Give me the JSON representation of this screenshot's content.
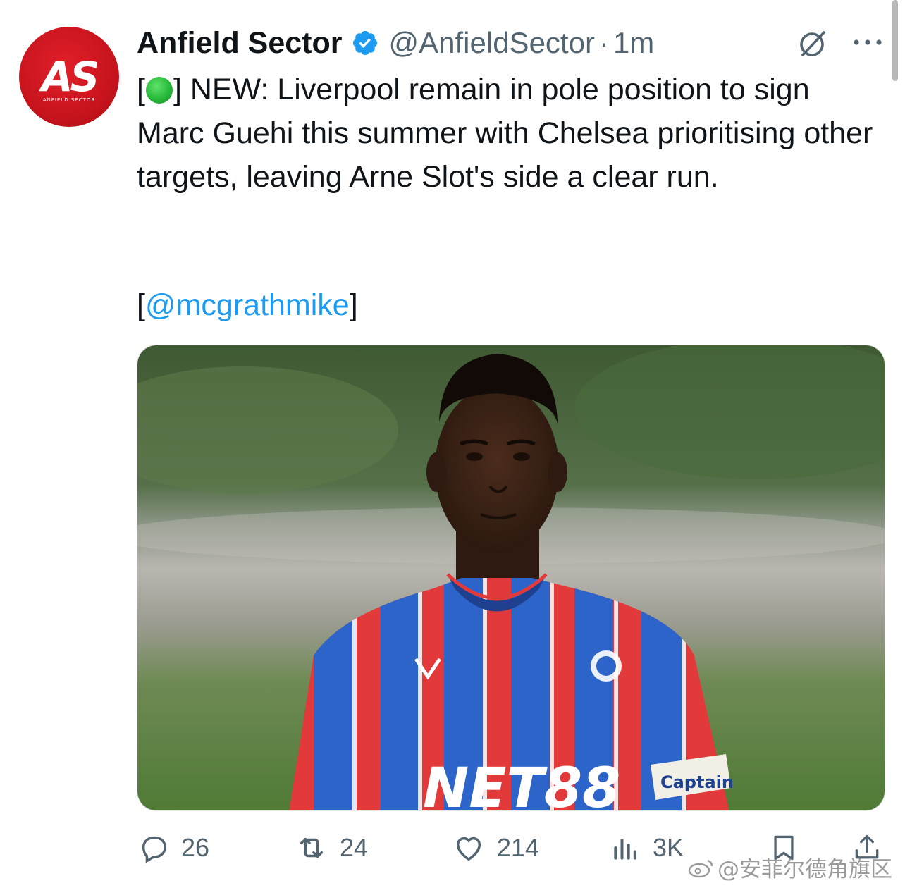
{
  "author": {
    "display_name": "Anfield Sector",
    "handle": "@AnfieldSector",
    "separator": "·",
    "time": "1m",
    "avatar_initials": "AS",
    "avatar_subtitle": "ANFIELD SECTOR",
    "verified_icon": "verified-badge-icon"
  },
  "tweet": {
    "text_prefix": "[",
    "status_icon": "green-circle-icon",
    "text_body": "] NEW: Liverpool remain in pole position to sign Marc Guehi this summer with Chelsea prioritising other targets, leaving Arne Slot's side a clear run.",
    "mention_open": "[",
    "mention": "@mcgrathmike",
    "mention_close": "]"
  },
  "media": {
    "jersey_sponsor": "NET88",
    "armband_text": "Captain"
  },
  "actions": {
    "replies": "26",
    "reposts": "24",
    "likes": "214",
    "views": "3K"
  },
  "watermark": {
    "text": "@安菲尔德角旗区"
  },
  "colors": {
    "accent": "#1d9bf0",
    "secondary_text": "#536471",
    "primary_text": "#0f1419",
    "avatar_red": "#c8141d"
  }
}
